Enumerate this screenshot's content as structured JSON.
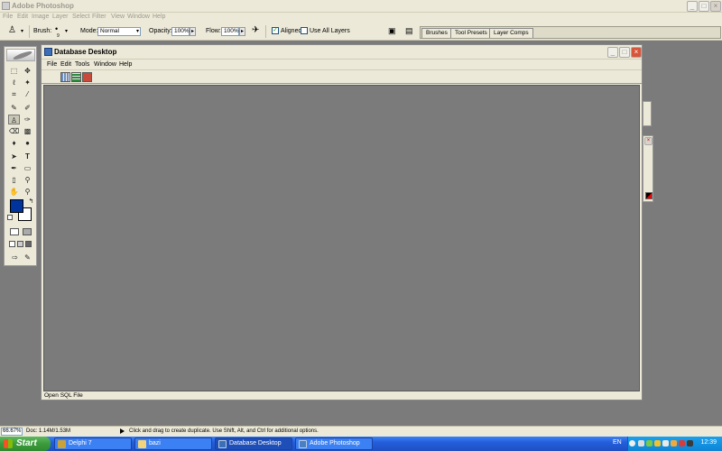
{
  "photoshop": {
    "title": "Adobe Photoshop",
    "menu": [
      "File",
      "Edit",
      "Image",
      "Layer",
      "Select",
      "Filter",
      "View",
      "Window",
      "Help"
    ],
    "options": {
      "brush_label": "Brush:",
      "brush_size": "9",
      "mode_label": "Mode:",
      "mode_value": "Normal",
      "opacity_label": "Opacity:",
      "opacity_value": "100%",
      "flow_label": "Flow:",
      "flow_value": "100%",
      "aligned_label": "Aligned",
      "aligned_checked": true,
      "use_all_layers_label": "Use All Layers",
      "use_all_layers_checked": false
    },
    "palette_tabs": [
      "Brushes",
      "Tool Presets",
      "Layer Comps"
    ],
    "foreground_color": "#00339c",
    "background_color": "#ffffff",
    "status": {
      "zoom": "66.67%",
      "doc": "Doc: 1.14M/1.53M",
      "hint": "Click and drag to create duplicate.  Use Shift, Alt, and Ctrl for additional options."
    }
  },
  "database_desktop": {
    "title": "Database Desktop",
    "menu": [
      "File",
      "Edit",
      "Tools",
      "Window",
      "Help"
    ],
    "status": "Open SQL File"
  },
  "taskbar": {
    "start_label": "Start",
    "tasks": [
      {
        "label": "Delphi 7",
        "active": false
      },
      {
        "label": "bazi",
        "active": false
      },
      {
        "label": "Database Desktop",
        "active": true
      },
      {
        "label": "Adobe Photoshop",
        "active": false
      }
    ],
    "language": "EN",
    "clock": "12:39"
  }
}
